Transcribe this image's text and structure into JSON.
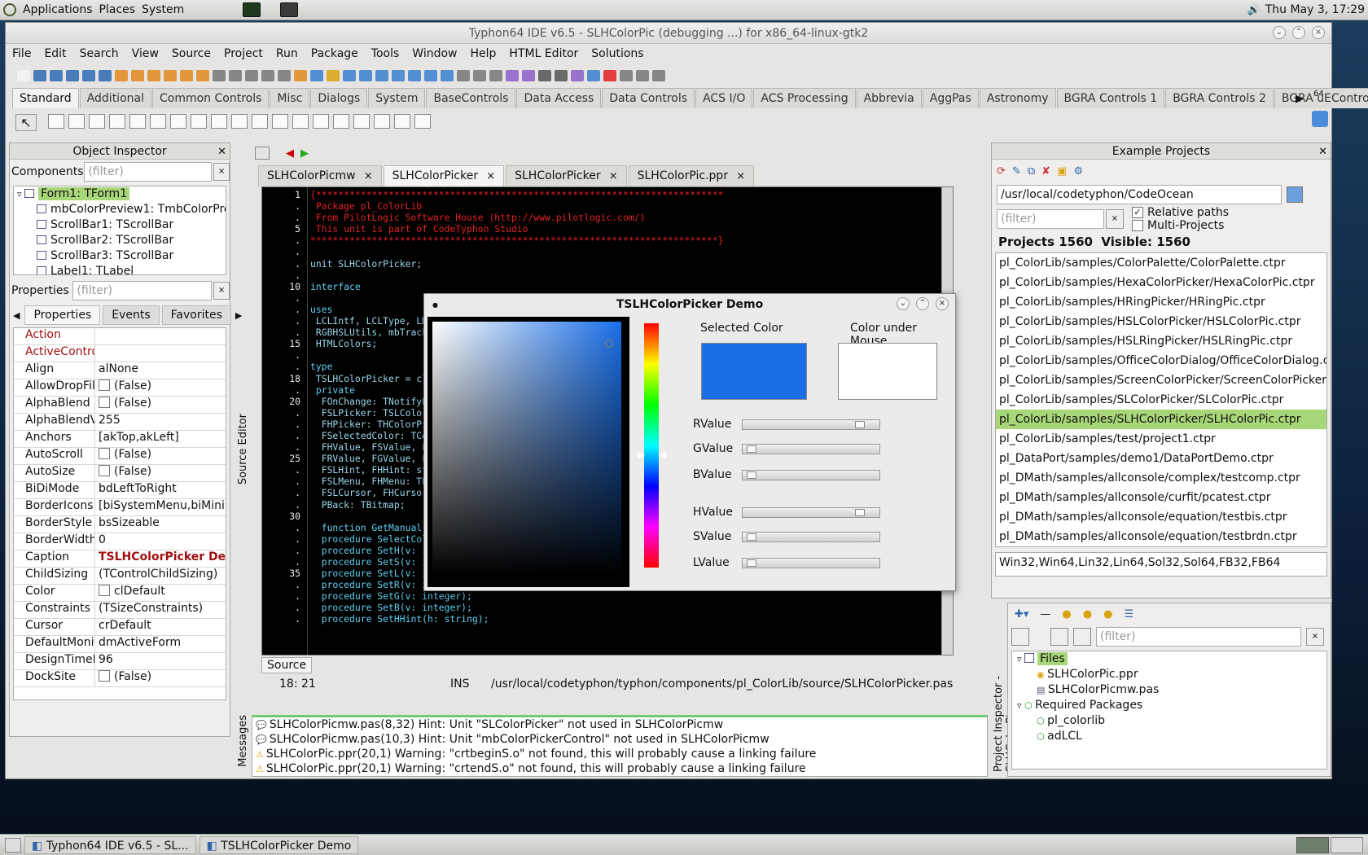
{
  "top_panel": {
    "applications": "Applications",
    "places": "Places",
    "system": "System",
    "clock": "Thu May  3, 17:29"
  },
  "window": {
    "title": "Typhon64 IDE v6.5 - SLHColorPic (debugging ...) for x86_64-linux-gtk2"
  },
  "menu": [
    "File",
    "Edit",
    "Search",
    "View",
    "Source",
    "Project",
    "Run",
    "Package",
    "Tools",
    "Window",
    "Help",
    "HTML Editor",
    "Solutions"
  ],
  "palette_tabs": [
    "Standard",
    "Additional",
    "Common Controls",
    "Misc",
    "Dialogs",
    "System",
    "BaseControls",
    "Data Access",
    "Data Controls",
    "ACS I/O",
    "ACS Processing",
    "Abbrevia",
    "AggPas",
    "Astronomy",
    "BGRA Controls 1",
    "BGRA Controls 2",
    "BGRA uEControls"
  ],
  "palette_badge": "64",
  "object_inspector": {
    "title": "Object Inspector",
    "components_label": "Components",
    "filter_placeholder": "(filter)",
    "tree": [
      "Form1: TForm1",
      "mbColorPreview1: TmbColorPre",
      "ScrollBar1: TScrollBar",
      "ScrollBar2: TScrollBar",
      "ScrollBar3: TScrollBar",
      "Label1: TLabel"
    ],
    "properties_label": "Properties",
    "tabs": [
      "Properties",
      "Events",
      "Favorites"
    ],
    "rows": [
      {
        "name": "Action",
        "value": ""
      },
      {
        "name": "ActiveControl",
        "value": ""
      },
      {
        "name": "Align",
        "value": "alNone"
      },
      {
        "name": "AllowDropFiles",
        "value": "(False)"
      },
      {
        "name": "AlphaBlend",
        "value": "(False)"
      },
      {
        "name": "AlphaBlendValue",
        "value": "255"
      },
      {
        "name": "Anchors",
        "value": "[akTop,akLeft]"
      },
      {
        "name": "AutoScroll",
        "value": "(False)"
      },
      {
        "name": "AutoSize",
        "value": "(False)"
      },
      {
        "name": "BiDiMode",
        "value": "bdLeftToRight"
      },
      {
        "name": "BorderIcons",
        "value": "[biSystemMenu,biMini"
      },
      {
        "name": "BorderStyle",
        "value": "bsSizeable"
      },
      {
        "name": "BorderWidth",
        "value": "0"
      },
      {
        "name": "Caption",
        "value": "TSLHColorPicker De"
      },
      {
        "name": "ChildSizing",
        "value": "(TControlChildSizing)"
      },
      {
        "name": "Color",
        "value": "clDefault"
      },
      {
        "name": "Constraints",
        "value": "(TSizeConstraints)"
      },
      {
        "name": "Cursor",
        "value": "crDefault"
      },
      {
        "name": "DefaultMonitor",
        "value": "dmActiveForm"
      },
      {
        "name": "DesignTimePPI",
        "value": "96"
      },
      {
        "name": "DockSite",
        "value": "(False)"
      }
    ]
  },
  "editor": {
    "side_label": "Source Editor",
    "tabs": [
      "SLHColorPicmw",
      "SLHColorPicker",
      "SLHColorPicker",
      "SLHColorPic.ppr"
    ],
    "lines": [
      {
        "n": "1",
        "t": "{*************************************************************************",
        "c": "red"
      },
      {
        "n": ".",
        "t": " Package pl_ColorLib",
        "c": "red"
      },
      {
        "n": ".",
        "t": " From PilotLogic Software House (http://www.pilotlogic.com/)",
        "c": "red"
      },
      {
        "n": "5",
        "t": " This unit is part of CodeTyphon Studio",
        "c": "red"
      },
      {
        "n": ".",
        "t": "*************************************************************************}",
        "c": "red"
      },
      {
        "n": ".",
        "t": "",
        "c": "cy"
      },
      {
        "n": ".",
        "t": "unit SLHColorPicker;",
        "c": "cy"
      },
      {
        "n": ".",
        "t": "",
        "c": "cy"
      },
      {
        "n": "10",
        "t": "interface",
        "c": "kw"
      },
      {
        "n": ".",
        "t": "",
        "c": "cy"
      },
      {
        "n": ".",
        "t": "uses",
        "c": "kw"
      },
      {
        "n": ".",
        "t": " LCLIntf, LCLType, LM",
        "c": "cy"
      },
      {
        "n": ".",
        "t": " RGBHSLUtils, mbTrack",
        "c": "cy"
      },
      {
        "n": "15",
        "t": " HTMLColors;",
        "c": "cy"
      },
      {
        "n": ".",
        "t": "",
        "c": "cy"
      },
      {
        "n": ".",
        "t": "type",
        "c": "kw"
      },
      {
        "n": "18",
        "t": " TSLHColorPicker = cl",
        "c": "cy"
      },
      {
        "n": ".",
        "t": " private",
        "c": "kw"
      },
      {
        "n": "20",
        "t": "  FOnChange: TNotifyE",
        "c": "cy"
      },
      {
        "n": ".",
        "t": "  FSLPicker: TSLColor",
        "c": "cy"
      },
      {
        "n": ".",
        "t": "  FHPicker: THColorPi",
        "c": "cy"
      },
      {
        "n": ".",
        "t": "  FSelectedColor: TCo",
        "c": "cy"
      },
      {
        "n": ".",
        "t": "  FHValue, FSValue, F",
        "c": "cy"
      },
      {
        "n": "25",
        "t": "  FRValue, FGValue, F",
        "c": "cy"
      },
      {
        "n": ".",
        "t": "  FSLHint, FHHint: st",
        "c": "cy"
      },
      {
        "n": ".",
        "t": "  FSLMenu, FHMenu: TP",
        "c": "cy"
      },
      {
        "n": ".",
        "t": "  FSLCursor, FHCursor",
        "c": "cy"
      },
      {
        "n": ".",
        "t": "  PBack: TBitmap;",
        "c": "cy"
      },
      {
        "n": "30",
        "t": "",
        "c": "cy"
      },
      {
        "n": ".",
        "t": "  function GetManual:",
        "c": "kw"
      },
      {
        "n": ".",
        "t": "  procedure SelectCol",
        "c": "kw"
      },
      {
        "n": ".",
        "t": "  procedure SetH(v: i",
        "c": "kw"
      },
      {
        "n": ".",
        "t": "  procedure SetS(v: integer);",
        "c": "kw"
      },
      {
        "n": "35",
        "t": "  procedure SetL(v: integer);",
        "c": "kw"
      },
      {
        "n": ".",
        "t": "  procedure SetR(v: integer);",
        "c": "kw"
      },
      {
        "n": ".",
        "t": "  procedure SetG(v: integer);",
        "c": "kw"
      },
      {
        "n": ".",
        "t": "  procedure SetB(v: integer);",
        "c": "kw"
      },
      {
        "n": ".",
        "t": "  procedure SetHHint(h: string);",
        "c": "kw"
      }
    ],
    "bottom_tab": "Source",
    "status_pos": "18: 21",
    "status_mode": "INS",
    "status_path": "/usr/local/codetyphon/typhon/components/pl_ColorLib/source/SLHColorPicker.pas"
  },
  "messages": {
    "side_label": "Messages",
    "lines": [
      {
        "icon": "hint",
        "text": "SLHColorPicmw.pas(8,32) Hint: Unit \"SLColorPicker\" not used in SLHColorPicmw"
      },
      {
        "icon": "hint",
        "text": "SLHColorPicmw.pas(10,3) Hint: Unit \"mbColorPickerControl\" not used in SLHColorPicmw"
      },
      {
        "icon": "warning",
        "text": "SLHColorPic.ppr(20,1) Warning: \"crtbeginS.o\" not found, this will probably cause a linking failure"
      },
      {
        "icon": "warning",
        "text": "SLHColorPic.ppr(20,1) Warning: \"crtendS.o\" not found, this will probably cause a linking failure"
      }
    ]
  },
  "dialog": {
    "title": "TSLHColorPicker Demo",
    "selected_label": "Selected Color",
    "mouse_label": "Color under Mouse",
    "selected_color": "#1a6fe8",
    "mouse_color": "#ffffff",
    "sliders": [
      {
        "label": "RValue",
        "level": 0.92
      },
      {
        "label": "GValue",
        "level": 0.03
      },
      {
        "label": "BValue",
        "level": 0.03
      },
      {
        "label": "HValue",
        "level": 0.92
      },
      {
        "label": "SValue",
        "level": 0.03
      },
      {
        "label": "LValue",
        "level": 0.03
      }
    ]
  },
  "example_projects": {
    "title": "Example Projects",
    "path": "/usr/local/codetyphon/CodeOcean",
    "filter_placeholder": "(filter)",
    "relative_paths": "Relative paths",
    "multi_projects": "Multi-Projects",
    "counts": "Projects 1560  Visible: 1560",
    "items": [
      "pl_ColorLib/samples/ColorPalette/ColorPalette.ctpr",
      "pl_ColorLib/samples/HexaColorPicker/HexaColorPic.ctpr",
      "pl_ColorLib/samples/HRingPicker/HRingPic.ctpr",
      "pl_ColorLib/samples/HSLColorPicker/HSLColorPic.ctpr",
      "pl_ColorLib/samples/HSLRingPicker/HSLRingPic.ctpr",
      "pl_ColorLib/samples/OfficeColorDialog/OfficeColorDialog.ct",
      "pl_ColorLib/samples/ScreenColorPicker/ScreenColorPicker.c",
      "pl_ColorLib/samples/SLColorPicker/SLColorPic.ctpr",
      "pl_ColorLib/samples/SLHColorPicker/SLHColorPic.ctpr",
      "pl_ColorLib/samples/test/project1.ctpr",
      "pl_DataPort/samples/demo1/DataPortDemo.ctpr",
      "pl_DMath/samples/allconsole/complex/testcomp.ctpr",
      "pl_DMath/samples/allconsole/curfit/pcatest.ctpr",
      "pl_DMath/samples/allconsole/equation/testbis.ctpr",
      "pl_DMath/samples/allconsole/equation/testbrdn.ctpr"
    ],
    "selected_index": 8,
    "platforms": "Win32,Win64,Lin32,Lin64,Sol32,Sol64,FB32,FB64"
  },
  "project_inspector": {
    "side_label": "Project Inspector - SLHColorPic",
    "filter_placeholder": "(filter)",
    "files_label": "Files",
    "files": [
      "SLHColorPic.ppr",
      "SLHColorPicmw.pas"
    ],
    "required_label": "Required Packages",
    "packages": [
      "pl_colorlib",
      "adLCL"
    ]
  },
  "taskbar": {
    "tasks": [
      "Typhon64 IDE v6.5 - SL...",
      "TSLHColorPicker Demo"
    ]
  }
}
